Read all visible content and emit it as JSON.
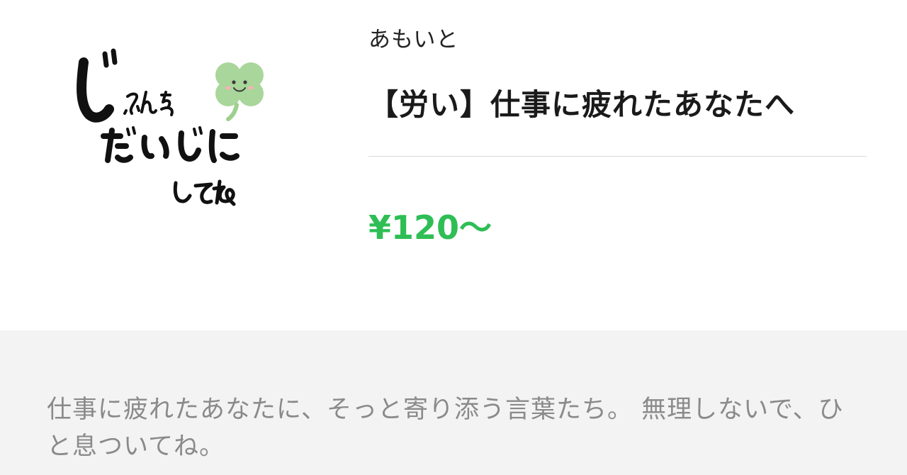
{
  "sticker": {
    "lettering": "じぶんをだいじにしてね",
    "icon": "clover-face-icon",
    "clover_color": "#a9d69a"
  },
  "product": {
    "author": "あもいと",
    "title": "【労い】仕事に疲れたあなたへ",
    "price": "¥120～",
    "price_color": "#2fbe55"
  },
  "description": {
    "text": "仕事に疲れたあなたに、そっと寄り添う言葉たち。 無理しないで、ひと息ついてね。"
  }
}
